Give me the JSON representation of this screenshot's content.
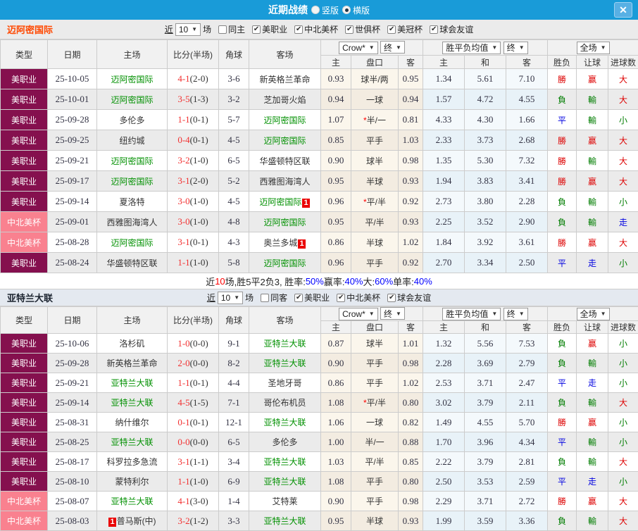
{
  "titlebar": {
    "title": "近期战绩",
    "radios": [
      {
        "label": "竖版",
        "selected": false
      },
      {
        "label": "横版",
        "selected": true
      }
    ]
  },
  "icons": {
    "caret": "▼",
    "check": "✔",
    "close": "✕",
    "star": "*"
  },
  "colors": {
    "title_blue": "#199bd8",
    "league_major_bg": "#85104e",
    "league_cup_bg": "#f9818f",
    "win_red": "#dd0000",
    "lose_green": "#007d00",
    "draw_blue": "#0000e0",
    "team_green": "#009000",
    "team_accent_orange": "#ff4800"
  },
  "columns": {
    "type": "类型",
    "date": "日期",
    "home": "主场",
    "score": "比分(半场)",
    "corner": "角球",
    "away": "客场",
    "sub": [
      "主",
      "盘口",
      "客",
      "主",
      "和",
      "客",
      "胜负",
      "让球",
      "进球数"
    ],
    "dd_crow": "Crow*",
    "dd_final": "终",
    "dd_avg": "胜平负均值",
    "dd_full": "全场"
  },
  "filters_shared": {
    "near": "近",
    "count": "10",
    "matches": "场"
  },
  "tables": [
    {
      "team": "迈阿密国际",
      "style": "orange",
      "same_label": "同主",
      "leagues": [
        "美职业",
        "中北美杯",
        "世俱杯",
        "美冠杯",
        "球会友谊"
      ],
      "summary": [
        [
          "近",
          "k"
        ],
        [
          "10",
          "r"
        ],
        [
          "场,胜5平2负3, 胜率:",
          "k"
        ],
        [
          "50%",
          "b"
        ],
        [
          " 赢率:",
          "k"
        ],
        [
          "40%",
          "b"
        ],
        [
          " 大:",
          "k"
        ],
        [
          "60%",
          "b"
        ],
        [
          " 单率:",
          "k"
        ],
        [
          "40%",
          "b"
        ]
      ],
      "rows": [
        {
          "league": "美职业",
          "cup": false,
          "date": "25-10-05",
          "home": {
            "name": "迈阿密国际",
            "green": true
          },
          "score": "4-1",
          "half": "(2-0)",
          "corner": "3-6",
          "away": {
            "name": "新英格兰革命"
          },
          "odds": [
            "0.93",
            "球半/两",
            "0.95"
          ],
          "star": false,
          "avg": [
            "1.34",
            "5.61",
            "7.10"
          ],
          "res": [
            [
              "勝",
              "r"
            ],
            [
              "赢",
              "r"
            ],
            [
              "大",
              "r"
            ]
          ]
        },
        {
          "league": "美职业",
          "cup": false,
          "date": "25-10-01",
          "home": {
            "name": "迈阿密国际",
            "green": true
          },
          "score": "3-5",
          "half": "(1-3)",
          "corner": "3-2",
          "away": {
            "name": "芝加哥火焰"
          },
          "odds": [
            "0.94",
            "一球",
            "0.94"
          ],
          "star": false,
          "avg": [
            "1.57",
            "4.72",
            "4.55"
          ],
          "res": [
            [
              "負",
              "g"
            ],
            [
              "輸",
              "g"
            ],
            [
              "大",
              "r"
            ]
          ]
        },
        {
          "league": "美职业",
          "cup": false,
          "date": "25-09-28",
          "home": {
            "name": "多伦多"
          },
          "score": "1-1",
          "half": "(0-1)",
          "corner": "5-7",
          "away": {
            "name": "迈阿密国际",
            "green": true
          },
          "odds": [
            "1.07",
            "半/一",
            "0.81"
          ],
          "star": true,
          "avg": [
            "4.33",
            "4.30",
            "1.66"
          ],
          "res": [
            [
              "平",
              "b"
            ],
            [
              "輸",
              "g"
            ],
            [
              "小",
              "g"
            ]
          ]
        },
        {
          "league": "美职业",
          "cup": false,
          "date": "25-09-25",
          "home": {
            "name": "纽约城"
          },
          "score": "0-4",
          "half": "(0-1)",
          "corner": "4-5",
          "away": {
            "name": "迈阿密国际",
            "green": true
          },
          "odds": [
            "0.85",
            "平手",
            "1.03"
          ],
          "star": false,
          "avg": [
            "2.33",
            "3.73",
            "2.68"
          ],
          "res": [
            [
              "勝",
              "r"
            ],
            [
              "赢",
              "r"
            ],
            [
              "大",
              "r"
            ]
          ]
        },
        {
          "league": "美职业",
          "cup": false,
          "date": "25-09-21",
          "home": {
            "name": "迈阿密国际",
            "green": true
          },
          "score": "3-2",
          "half": "(1-0)",
          "corner": "6-5",
          "away": {
            "name": "华盛顿特区联"
          },
          "odds": [
            "0.90",
            "球半",
            "0.98"
          ],
          "star": false,
          "avg": [
            "1.35",
            "5.30",
            "7.32"
          ],
          "res": [
            [
              "勝",
              "r"
            ],
            [
              "輸",
              "g"
            ],
            [
              "大",
              "r"
            ]
          ]
        },
        {
          "league": "美职业",
          "cup": false,
          "date": "25-09-17",
          "home": {
            "name": "迈阿密国际",
            "green": true
          },
          "score": "3-1",
          "half": "(2-0)",
          "corner": "5-2",
          "away": {
            "name": "西雅图海湾人"
          },
          "odds": [
            "0.95",
            "半球",
            "0.93"
          ],
          "star": false,
          "avg": [
            "1.94",
            "3.83",
            "3.41"
          ],
          "res": [
            [
              "勝",
              "r"
            ],
            [
              "赢",
              "r"
            ],
            [
              "大",
              "r"
            ]
          ]
        },
        {
          "league": "美职业",
          "cup": false,
          "date": "25-09-14",
          "home": {
            "name": "夏洛特"
          },
          "score": "3-0",
          "half": "(1-0)",
          "corner": "4-5",
          "away": {
            "name": "迈阿密国际",
            "green": true,
            "badge": "1",
            "badge_pos": "after"
          },
          "odds": [
            "0.96",
            "平/半",
            "0.92"
          ],
          "star": true,
          "avg": [
            "2.73",
            "3.80",
            "2.28"
          ],
          "res": [
            [
              "負",
              "g"
            ],
            [
              "輸",
              "g"
            ],
            [
              "小",
              "g"
            ]
          ]
        },
        {
          "league": "中北美杯",
          "cup": true,
          "date": "25-09-01",
          "home": {
            "name": "西雅图海湾人"
          },
          "score": "3-0",
          "half": "(1-0)",
          "corner": "4-8",
          "away": {
            "name": "迈阿密国际",
            "green": true
          },
          "odds": [
            "0.95",
            "平/半",
            "0.93"
          ],
          "star": false,
          "avg": [
            "2.25",
            "3.52",
            "2.90"
          ],
          "res": [
            [
              "負",
              "g"
            ],
            [
              "輸",
              "g"
            ],
            [
              "走",
              "b"
            ]
          ]
        },
        {
          "league": "中北美杯",
          "cup": true,
          "date": "25-08-28",
          "home": {
            "name": "迈阿密国际",
            "green": true
          },
          "score": "3-1",
          "half": "(0-1)",
          "corner": "4-3",
          "away": {
            "name": "奥兰多城",
            "badge": "1",
            "badge_pos": "after"
          },
          "odds": [
            "0.86",
            "半球",
            "1.02"
          ],
          "star": false,
          "avg": [
            "1.84",
            "3.92",
            "3.61"
          ],
          "res": [
            [
              "勝",
              "r"
            ],
            [
              "赢",
              "r"
            ],
            [
              "大",
              "r"
            ]
          ]
        },
        {
          "league": "美职业",
          "cup": false,
          "date": "25-08-24",
          "home": {
            "name": "华盛顿特区联"
          },
          "score": "1-1",
          "half": "(1-0)",
          "corner": "5-8",
          "away": {
            "name": "迈阿密国际",
            "green": true
          },
          "odds": [
            "0.96",
            "平手",
            "0.92"
          ],
          "star": false,
          "avg": [
            "2.70",
            "3.34",
            "2.50"
          ],
          "res": [
            [
              "平",
              "b"
            ],
            [
              "走",
              "b"
            ],
            [
              "小",
              "g"
            ]
          ]
        }
      ]
    },
    {
      "team": "亚特兰大联",
      "style": "dark",
      "same_label": "同客",
      "leagues": [
        "美职业",
        "中北美杯",
        "球会友谊"
      ],
      "summary": null,
      "rows": [
        {
          "league": "美职业",
          "cup": false,
          "date": "25-10-06",
          "home": {
            "name": "洛杉矶"
          },
          "score": "1-0",
          "half": "(0-0)",
          "corner": "9-1",
          "away": {
            "name": "亚特兰大联",
            "green": true
          },
          "odds": [
            "0.87",
            "球半",
            "1.01"
          ],
          "star": false,
          "avg": [
            "1.32",
            "5.56",
            "7.53"
          ],
          "res": [
            [
              "負",
              "g"
            ],
            [
              "赢",
              "r"
            ],
            [
              "小",
              "g"
            ]
          ]
        },
        {
          "league": "美职业",
          "cup": false,
          "date": "25-09-28",
          "home": {
            "name": "新英格兰革命"
          },
          "score": "2-0",
          "half": "(0-0)",
          "corner": "8-2",
          "away": {
            "name": "亚特兰大联",
            "green": true
          },
          "odds": [
            "0.90",
            "平手",
            "0.98"
          ],
          "star": false,
          "avg": [
            "2.28",
            "3.69",
            "2.79"
          ],
          "res": [
            [
              "負",
              "g"
            ],
            [
              "輸",
              "g"
            ],
            [
              "小",
              "g"
            ]
          ]
        },
        {
          "league": "美职业",
          "cup": false,
          "date": "25-09-21",
          "home": {
            "name": "亚特兰大联",
            "green": true
          },
          "score": "1-1",
          "half": "(0-1)",
          "corner": "4-4",
          "away": {
            "name": "圣地牙哥"
          },
          "odds": [
            "0.86",
            "平手",
            "1.02"
          ],
          "star": false,
          "avg": [
            "2.53",
            "3.71",
            "2.47"
          ],
          "res": [
            [
              "平",
              "b"
            ],
            [
              "走",
              "b"
            ],
            [
              "小",
              "g"
            ]
          ]
        },
        {
          "league": "美职业",
          "cup": false,
          "date": "25-09-14",
          "home": {
            "name": "亚特兰大联",
            "green": true
          },
          "score": "4-5",
          "half": "(1-5)",
          "corner": "7-1",
          "away": {
            "name": "哥伦布机员"
          },
          "odds": [
            "1.08",
            "平/半",
            "0.80"
          ],
          "star": true,
          "avg": [
            "3.02",
            "3.79",
            "2.11"
          ],
          "res": [
            [
              "負",
              "g"
            ],
            [
              "輸",
              "g"
            ],
            [
              "大",
              "r"
            ]
          ]
        },
        {
          "league": "美职业",
          "cup": false,
          "date": "25-08-31",
          "home": {
            "name": "纳什维尔"
          },
          "score": "0-1",
          "half": "(0-1)",
          "corner": "12-1",
          "away": {
            "name": "亚特兰大联",
            "green": true
          },
          "odds": [
            "1.06",
            "一球",
            "0.82"
          ],
          "star": false,
          "avg": [
            "1.49",
            "4.55",
            "5.70"
          ],
          "res": [
            [
              "勝",
              "r"
            ],
            [
              "赢",
              "r"
            ],
            [
              "小",
              "g"
            ]
          ]
        },
        {
          "league": "美职业",
          "cup": false,
          "date": "25-08-25",
          "home": {
            "name": "亚特兰大联",
            "green": true
          },
          "score": "0-0",
          "half": "(0-0)",
          "corner": "6-5",
          "away": {
            "name": "多伦多"
          },
          "odds": [
            "1.00",
            "半/一",
            "0.88"
          ],
          "star": false,
          "avg": [
            "1.70",
            "3.96",
            "4.34"
          ],
          "res": [
            [
              "平",
              "b"
            ],
            [
              "輸",
              "g"
            ],
            [
              "小",
              "g"
            ]
          ]
        },
        {
          "league": "美职业",
          "cup": false,
          "date": "25-08-17",
          "home": {
            "name": "科罗拉多急流"
          },
          "score": "3-1",
          "half": "(1-1)",
          "corner": "3-4",
          "away": {
            "name": "亚特兰大联",
            "green": true
          },
          "odds": [
            "1.03",
            "平/半",
            "0.85"
          ],
          "star": false,
          "avg": [
            "2.22",
            "3.79",
            "2.81"
          ],
          "res": [
            [
              "負",
              "g"
            ],
            [
              "輸",
              "g"
            ],
            [
              "大",
              "r"
            ]
          ]
        },
        {
          "league": "美职业",
          "cup": false,
          "date": "25-08-10",
          "home": {
            "name": "蒙特利尔"
          },
          "score": "1-1",
          "half": "(1-0)",
          "corner": "6-9",
          "away": {
            "name": "亚特兰大联",
            "green": true
          },
          "odds": [
            "1.08",
            "平手",
            "0.80"
          ],
          "star": false,
          "avg": [
            "2.50",
            "3.53",
            "2.59"
          ],
          "res": [
            [
              "平",
              "b"
            ],
            [
              "走",
              "b"
            ],
            [
              "小",
              "g"
            ]
          ]
        },
        {
          "league": "中北美杯",
          "cup": true,
          "date": "25-08-07",
          "home": {
            "name": "亚特兰大联",
            "green": true
          },
          "score": "4-1",
          "half": "(3-0)",
          "corner": "1-4",
          "away": {
            "name": "艾特莱"
          },
          "odds": [
            "0.90",
            "平手",
            "0.98"
          ],
          "star": false,
          "avg": [
            "2.29",
            "3.71",
            "2.72"
          ],
          "res": [
            [
              "勝",
              "r"
            ],
            [
              "赢",
              "r"
            ],
            [
              "大",
              "r"
            ]
          ]
        },
        {
          "league": "中北美杯",
          "cup": true,
          "date": "25-08-03",
          "home": {
            "name": "普马斯(中)",
            "badge": "1",
            "badge_pos": "before"
          },
          "score": "3-2",
          "half": "(1-2)",
          "corner": "3-3",
          "away": {
            "name": "亚特兰大联",
            "green": true
          },
          "odds": [
            "0.95",
            "半球",
            "0.93"
          ],
          "star": false,
          "avg": [
            "1.99",
            "3.59",
            "3.36"
          ],
          "res": [
            [
              "負",
              "g"
            ],
            [
              "輸",
              "g"
            ],
            [
              "大",
              "r"
            ]
          ]
        }
      ]
    }
  ]
}
